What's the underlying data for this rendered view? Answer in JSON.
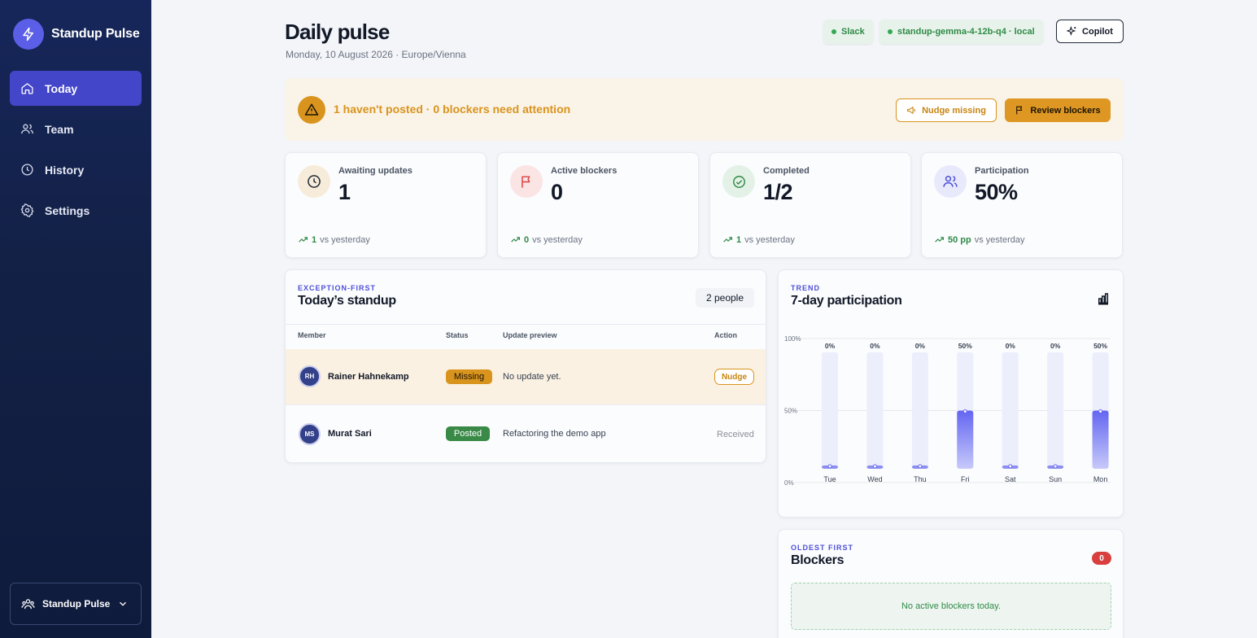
{
  "app": {
    "name": "Standup Pulse"
  },
  "sidebar": {
    "items": [
      {
        "label": "Today",
        "icon": "home-icon",
        "active": true
      },
      {
        "label": "Team",
        "icon": "users-icon",
        "active": false
      },
      {
        "label": "History",
        "icon": "clock-icon",
        "active": false
      },
      {
        "label": "Settings",
        "icon": "gear-icon",
        "active": false
      }
    ],
    "workspace": {
      "label": "Standup Pulse"
    }
  },
  "header": {
    "title": "Daily pulse",
    "subtitle": "Monday, 10 August 2026 · Europe/Vienna",
    "status_slack": "Slack",
    "status_model": "standup-gemma-4-12b-q4 · local",
    "copilot_label": "Copilot"
  },
  "alert": {
    "text": "1 haven't posted · 0 blockers need attention",
    "nudge_label": "Nudge missing",
    "review_label": "Review blockers"
  },
  "stats": [
    {
      "label": "Awaiting updates",
      "value": "1",
      "delta": "1",
      "delta_suffix": "vs yesterday",
      "icon": "clock-icon",
      "tint": "#f7ecd9"
    },
    {
      "label": "Active blockers",
      "value": "0",
      "delta": "0",
      "delta_suffix": "vs yesterday",
      "icon": "flag-icon",
      "tint": "#fbe4e4"
    },
    {
      "label": "Completed",
      "value": "1/2",
      "delta": "1",
      "delta_suffix": "vs yesterday",
      "icon": "check-circle-icon",
      "tint": "#e3f1e7"
    },
    {
      "label": "Participation",
      "value": "50%",
      "delta": "50 pp",
      "delta_suffix": "vs yesterday",
      "icon": "users-icon",
      "tint": "#e8e9fb"
    }
  ],
  "standup": {
    "eyebrow": "EXCEPTION-FIRST",
    "title": "Today’s standup",
    "people_count": "2 people",
    "columns": [
      "Member",
      "Status",
      "Update preview",
      "Action"
    ],
    "rows": [
      {
        "initials": "RH",
        "name": "Rainer Hahnekamp",
        "status": "Missing",
        "preview": "No update yet.",
        "action": "Nudge"
      },
      {
        "initials": "MS",
        "name": "Murat Sari",
        "status": "Posted",
        "preview": "Refactoring the demo app",
        "action": "Received"
      }
    ]
  },
  "trend": {
    "eyebrow": "TREND",
    "title": "7-day participation"
  },
  "chart_data": {
    "type": "bar",
    "categories": [
      "Tue",
      "Wed",
      "Thu",
      "Fri",
      "Sat",
      "Sun",
      "Mon"
    ],
    "values": [
      0,
      0,
      0,
      50,
      0,
      0,
      50
    ],
    "value_labels": [
      "0%",
      "0%",
      "0%",
      "50%",
      "0%",
      "0%",
      "50%"
    ],
    "y_ticks": [
      "0%",
      "50%",
      "100%"
    ],
    "ylim": [
      0,
      100
    ],
    "grid": true,
    "bar_color": "#6366f1"
  },
  "blockers": {
    "eyebrow": "OLDEST FIRST",
    "title": "Blockers",
    "count": "0",
    "empty_text": "No active blockers today."
  },
  "colors": {
    "accent": "#4346c9",
    "warning": "#d9941d",
    "success": "#2f8a46",
    "danger": "#d84040"
  }
}
